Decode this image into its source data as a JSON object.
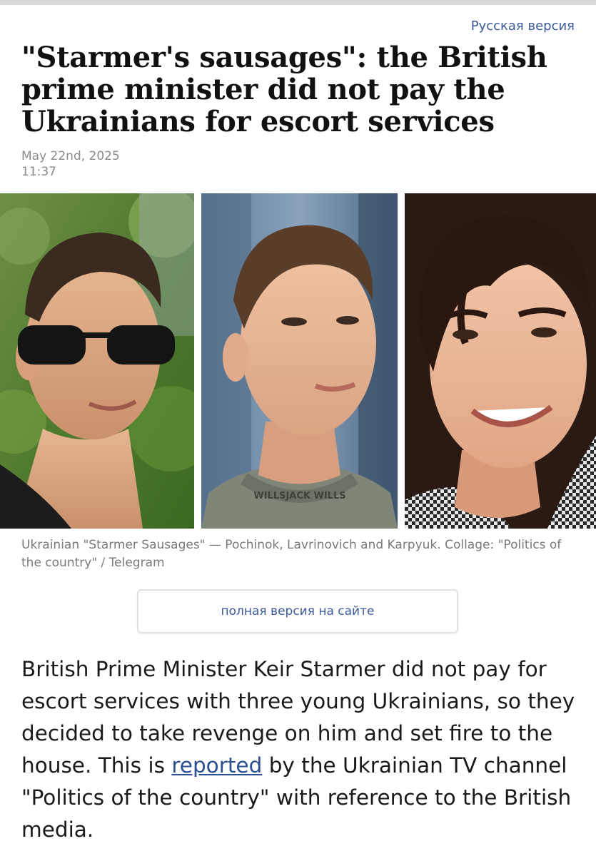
{
  "header": {
    "language_link": "Русская версия"
  },
  "article": {
    "title": "\"Starmer's sausages\": the British prime minister did not pay the Ukrainians for escort services",
    "date": "May 22nd, 2025",
    "time": "11:37",
    "caption": "Ukrainian \"Starmer Sausages\" — Pochinok, Lavrinovich and Karpyuk. Collage: \"Politics of the country\" / Telegram",
    "full_version_button": "полная версия на сайте",
    "body": {
      "part1": "British Prime Minister Keir Starmer did not pay for escort services with three young Ukrainians, so they decided to take revenge on him and set fire to the house. This is ",
      "link_text": "reported",
      "part2": " by the Ukrainian TV channel \"Politics of the country\" with reference to the British media."
    }
  },
  "photos": {
    "shirt_text": "WILLSJACK WILLS"
  },
  "colors": {
    "link": "#3a5a9a",
    "body_link": "#2a4f93",
    "meta": "#8a8a8a"
  }
}
